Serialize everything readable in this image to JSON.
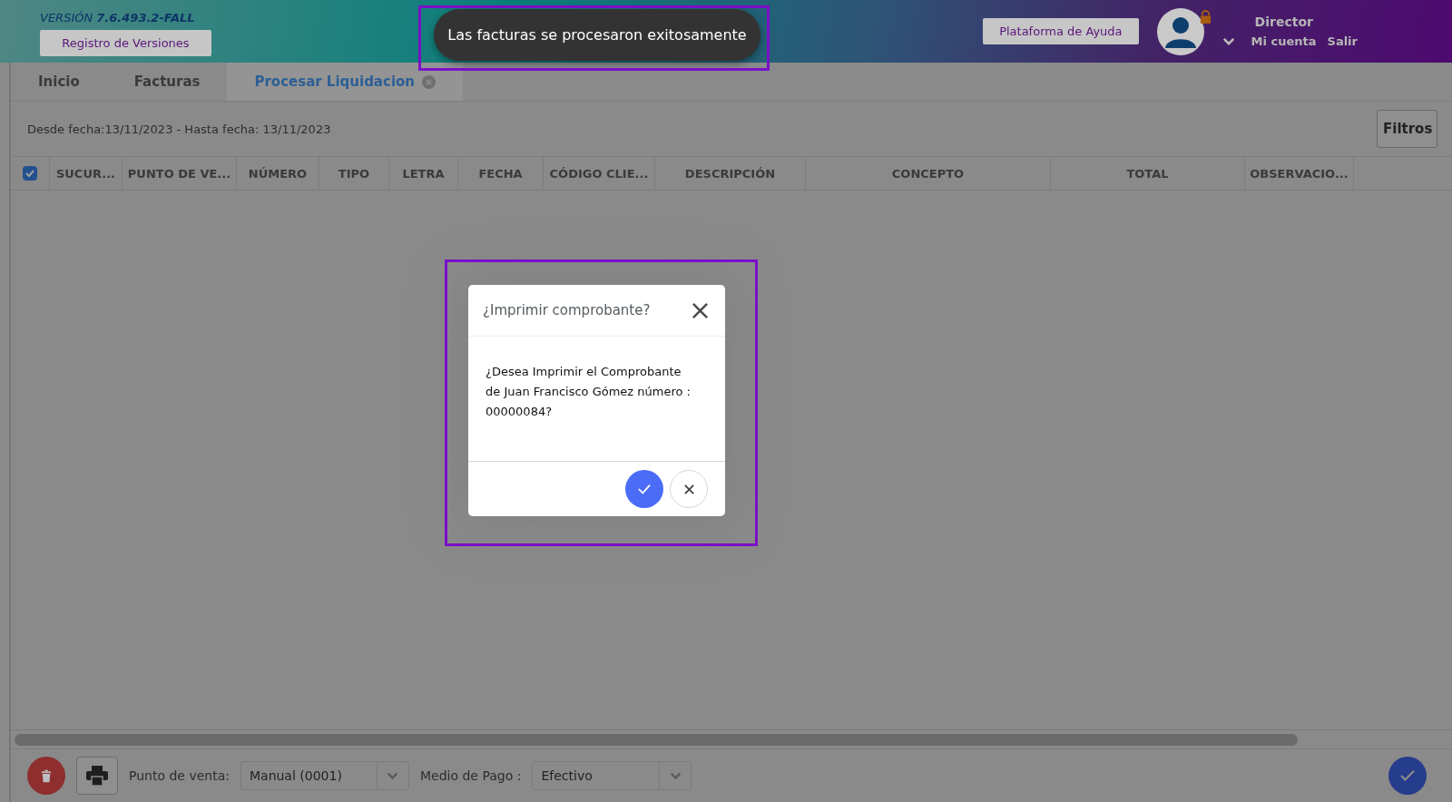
{
  "header": {
    "version": "VERSIÓN **7.6.493.2-FALL**",
    "versions_button": "Registro de Versiones",
    "help_button": "Plataforma de Ayuda",
    "user": {
      "role": "Director",
      "account_link": "Mi cuenta",
      "logout_link": "Salir"
    }
  },
  "toast": {
    "message": "Las facturas se procesaron exitosamente"
  },
  "tabs": [
    {
      "label": "Inicio",
      "selected": false,
      "closable": false
    },
    {
      "label": "Facturas",
      "selected": false,
      "closable": false
    },
    {
      "label": "Procesar Liquidacion",
      "selected": true,
      "closable": true
    }
  ],
  "filter_bar": {
    "date_range": "Desde fecha:13/11/2023 - Hasta fecha: 13/11/2023",
    "filters_button": "Filtros"
  },
  "table": {
    "select_all_checked": true,
    "columns": [
      "SUCUR...",
      "PUNTO DE VE...",
      "NÚMERO",
      "TIPO",
      "LETRA",
      "FECHA",
      "CÓDIGO CLIE...",
      "DESCRIPCIÓN",
      "CONCEPTO",
      "TOTAL",
      "OBSERVACIO..."
    ]
  },
  "dialog": {
    "title": "¿Imprimir comprobante?",
    "message": "¿Desea Imprimir el Comprobante de Juan Francisco Gómez número : 00000084?"
  },
  "footer": {
    "point_of_sale_label": "Punto de venta:",
    "point_of_sale_value": "Manual (0001)",
    "payment_label": "Medio de Pago :",
    "payment_value": "Efectivo"
  }
}
